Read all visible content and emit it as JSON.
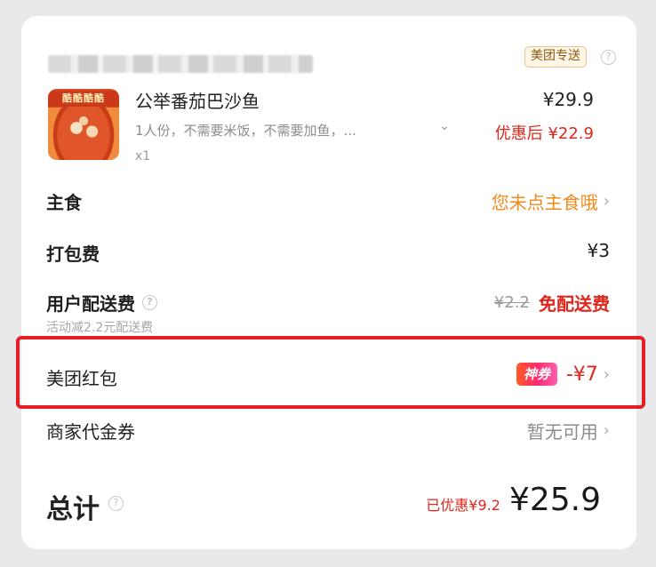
{
  "shop": {
    "delivery_tag": "美团专送"
  },
  "item": {
    "image_banner": "酷酷酷酷",
    "name": "公举番茄巴沙鱼",
    "desc": "1人份，不需要米饭，不需要加鱼，...",
    "desc_expand_icon": "chevron-down-icon",
    "qty": "x1",
    "price": "¥29.9",
    "discount_price": "优惠后 ¥22.9"
  },
  "rows": {
    "staple": {
      "label": "主食",
      "value": "您未点主食哦"
    },
    "packing": {
      "label": "打包费",
      "value": "¥3"
    },
    "delivery": {
      "label": "用户配送费",
      "original": "¥2.2",
      "value": "免配送费",
      "note": "活动减2.2元配送费"
    },
    "redpack": {
      "label": "美团红包",
      "badge": "神券",
      "value": "-¥7"
    },
    "voucher": {
      "label": "商家代金券",
      "value": "暂无可用"
    }
  },
  "total": {
    "label": "总计",
    "saved": "已优惠¥9.2",
    "amount": "¥25.9"
  },
  "colors": {
    "accent_red": "#e1251b",
    "accent_orange": "#f08a1d",
    "highlight_border": "#e51e25"
  }
}
